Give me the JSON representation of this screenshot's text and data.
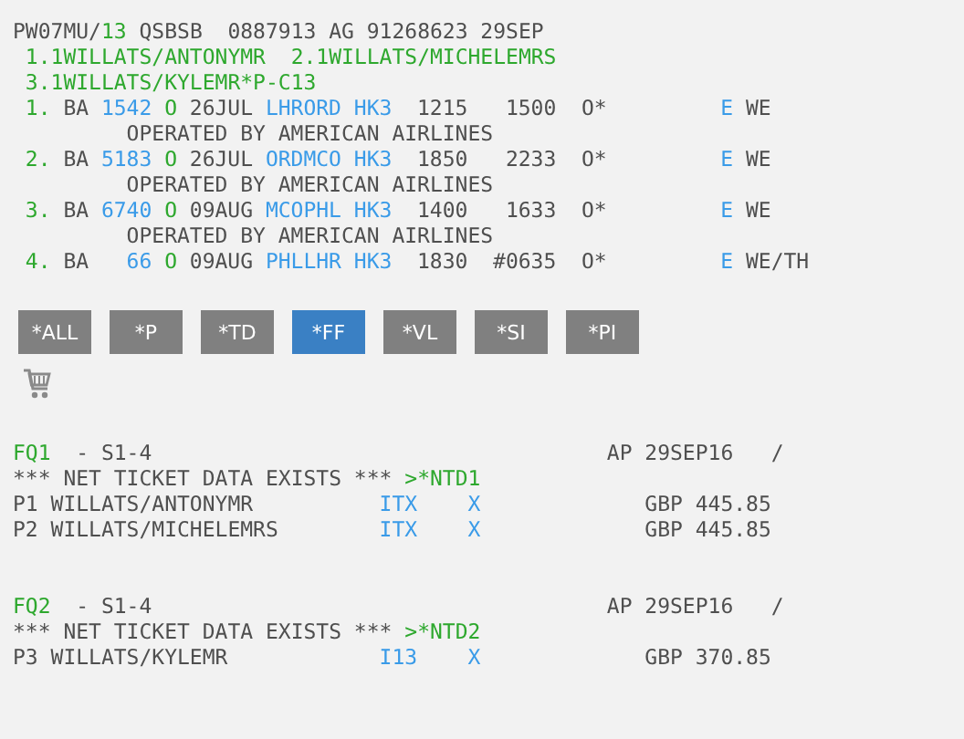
{
  "record": {
    "office": "PW07MU/",
    "agent": "13",
    "reference": "QSBSB  0887913 AG 91268623 29SEP"
  },
  "passengers": [
    "1.1WILLATS/ANTONYMR",
    "2.1WILLATS/MICHELEMRS",
    "3.1WILLATS/KYLEMR*P-C13"
  ],
  "segments": [
    {
      "number": "1.",
      "airline": "BA",
      "flight": "1542",
      "class": "O",
      "date": "26JUL",
      "route": "LHRORD",
      "status": "HK3",
      "depart": "1215",
      "arrive": "1500",
      "info": "O*",
      "eticket": "E",
      "days": "WE",
      "operated_by": "OPERATED BY AMERICAN AIRLINES"
    },
    {
      "number": "2.",
      "airline": "BA",
      "flight": "5183",
      "class": "O",
      "date": "26JUL",
      "route": "ORDMCO",
      "status": "HK3",
      "depart": "1850",
      "arrive": "2233",
      "info": "O*",
      "eticket": "E",
      "days": "WE",
      "operated_by": "OPERATED BY AMERICAN AIRLINES"
    },
    {
      "number": "3.",
      "airline": "BA",
      "flight": "6740",
      "class": "O",
      "date": "09AUG",
      "route": "MCOPHL",
      "status": "HK3",
      "depart": "1400",
      "arrive": "1633",
      "info": "O*",
      "eticket": "E",
      "days": "WE",
      "operated_by": "OPERATED BY AMERICAN AIRLINES"
    },
    {
      "number": "4.",
      "airline": "BA",
      "flight": "66",
      "class": "O",
      "date": "09AUG",
      "route": "PHLLHR",
      "status": "HK3",
      "depart": "1830",
      "arrive": "#0635",
      "info": "O*",
      "eticket": "E",
      "days": "WE/TH"
    }
  ],
  "tabs": [
    {
      "label": "*ALL",
      "selected": false
    },
    {
      "label": "*P",
      "selected": false
    },
    {
      "label": "*TD",
      "selected": false
    },
    {
      "label": "*FF",
      "selected": true
    },
    {
      "label": "*VL",
      "selected": false
    },
    {
      "label": "*SI",
      "selected": false
    },
    {
      "label": "*PI",
      "selected": false
    }
  ],
  "fares": [
    {
      "quote": "FQ1",
      "segments": "- S1-4",
      "date": "AP 29SEP16",
      "separator": "/",
      "notice": "*** NET TICKET DATA EXISTS ***",
      "link": ">*NTD1",
      "passengers": [
        {
          "name": "P1 WILLATS/ANTONYMR",
          "fare_basis": "ITX",
          "flag": "X",
          "amount": "GBP 445.85"
        },
        {
          "name": "P2 WILLATS/MICHELEMRS",
          "fare_basis": "ITX",
          "flag": "X",
          "amount": "GBP 445.85"
        }
      ]
    },
    {
      "quote": "FQ2",
      "segments": "- S1-4",
      "date": "AP 29SEP16",
      "separator": "/",
      "notice": "*** NET TICKET DATA EXISTS ***",
      "link": ">*NTD2",
      "passengers": [
        {
          "name": "P3 WILLATS/KYLEMR",
          "fare_basis": "I13",
          "flag": "X",
          "amount": "GBP 370.85"
        }
      ]
    }
  ]
}
